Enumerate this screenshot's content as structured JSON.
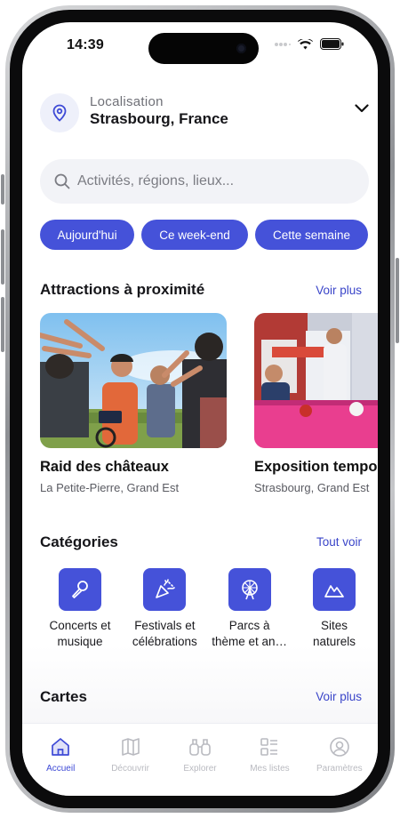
{
  "status_bar": {
    "time": "14:39"
  },
  "location": {
    "label": "Localisation",
    "value": "Strasbourg, France",
    "icons": [
      "location-pin-icon",
      "chevron-down-icon"
    ]
  },
  "search": {
    "placeholder": "Activités, régions, lieux..."
  },
  "date_filters": [
    "Aujourd'hui",
    "Ce week-end",
    "Cette semaine"
  ],
  "attractions": {
    "title": "Attractions à proximité",
    "more": "Voir plus",
    "items": [
      {
        "title": "Raid des châteaux",
        "subtitle": "La Petite-Pierre, Grand Est"
      },
      {
        "title": "Exposition tempo",
        "subtitle": "Strasbourg, Grand Est"
      }
    ]
  },
  "categories": {
    "title": "Catégories",
    "more": "Tout voir",
    "items": [
      {
        "line1": "Concerts et",
        "line2": "musique",
        "icon": "microphone-icon"
      },
      {
        "line1": "Festivals et",
        "line2": "célébrations",
        "icon": "party-popper-icon"
      },
      {
        "line1": "Parcs à",
        "line2": "thème et an…",
        "icon": "ferris-wheel-icon"
      },
      {
        "line1": "Sites",
        "line2": "naturels",
        "icon": "mountain-icon"
      }
    ]
  },
  "maps": {
    "title": "Cartes",
    "more": "Voir plus"
  },
  "tabbar": {
    "items": [
      {
        "label": "Accueil",
        "icon": "home-icon",
        "active": true
      },
      {
        "label": "Découvrir",
        "icon": "map-icon",
        "active": false
      },
      {
        "label": "Explorer",
        "icon": "binoculars-icon",
        "active": false
      },
      {
        "label": "Mes listes",
        "icon": "list-icon",
        "active": false
      },
      {
        "label": "Paramètres",
        "icon": "user-circle-icon",
        "active": false
      }
    ]
  },
  "colors": {
    "accent": "#4552d9",
    "text": "#16161a",
    "muted": "#6f7077",
    "inactive": "#b9bac0"
  }
}
